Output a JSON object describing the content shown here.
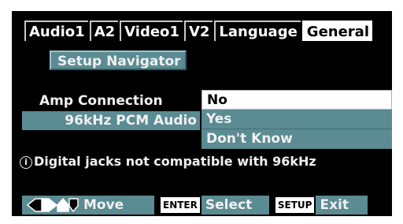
{
  "tabs": [
    {
      "label": "Audio1",
      "active": false
    },
    {
      "label": "A2",
      "active": false
    },
    {
      "label": "Video1",
      "active": false
    },
    {
      "label": "V2",
      "active": false
    },
    {
      "label": "Language",
      "active": false
    },
    {
      "label": "General",
      "active": true
    }
  ],
  "setup_navigator": "Setup Navigator",
  "amp_connection": {
    "label": "Amp Connection",
    "sub_label": "96kHz PCM Audio",
    "options": [
      "No",
      "Yes",
      "Don't Know"
    ],
    "selected": "No"
  },
  "info": {
    "icon": "info-icon",
    "text": "Digital jacks not compatible with 96kHz"
  },
  "footer": {
    "move_label": "Move",
    "enter_key": "ENTER",
    "select_label": "Select",
    "setup_key": "SETUP",
    "exit_label": "Exit"
  },
  "colors": {
    "background": "#000000",
    "panel_teal": "#5b8b93",
    "selected": "#ffffff"
  }
}
